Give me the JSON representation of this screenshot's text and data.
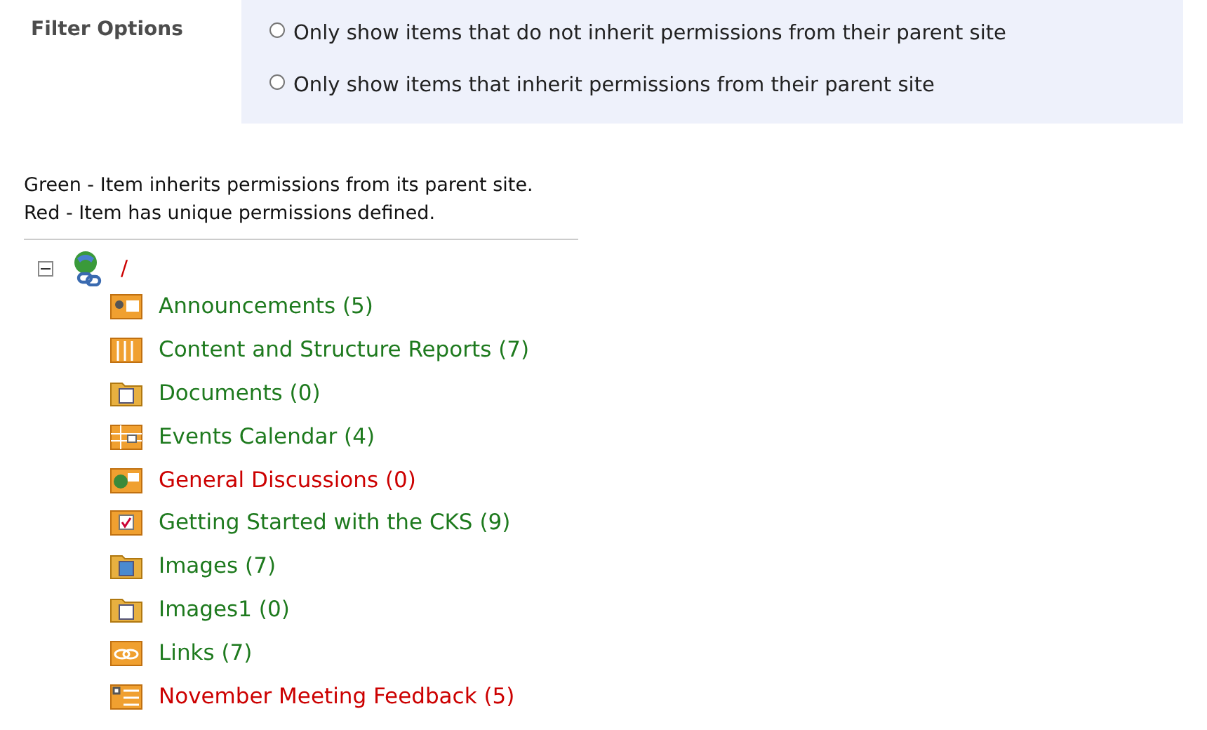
{
  "filter": {
    "label": "Filter Options",
    "options": [
      {
        "label": "Only show items that do not inherit permissions from their parent site",
        "selected": false
      },
      {
        "label": "Only show items that inherit permissions from their parent site",
        "selected": false
      }
    ]
  },
  "legend": [
    "Green - Item inherits permissions from its parent site.",
    "Red - Item has unique permissions defined."
  ],
  "tree": {
    "label": "/",
    "color": "#cc0000",
    "expanded": true,
    "children": [
      {
        "label": "Announcements (5)",
        "color": "#1e7a1e",
        "kind": "announcements"
      },
      {
        "label": "Content and Structure Reports (7)",
        "color": "#1e7a1e",
        "kind": "columns"
      },
      {
        "label": "Documents (0)",
        "color": "#1e7a1e",
        "kind": "doc-folder"
      },
      {
        "label": "Events Calendar (4)",
        "color": "#1e7a1e",
        "kind": "calendar"
      },
      {
        "label": "General Discussions (0)",
        "color": "#cc0000",
        "kind": "discussion"
      },
      {
        "label": "Getting Started with the CKS (9)",
        "color": "#1e7a1e",
        "kind": "task"
      },
      {
        "label": "Images (7)",
        "color": "#1e7a1e",
        "kind": "image-folder"
      },
      {
        "label": "Images1 (0)",
        "color": "#1e7a1e",
        "kind": "doc-folder"
      },
      {
        "label": "Links (7)",
        "color": "#1e7a1e",
        "kind": "links"
      },
      {
        "label": "November Meeting Feedback (5)",
        "color": "#cc0000",
        "kind": "survey"
      }
    ]
  }
}
